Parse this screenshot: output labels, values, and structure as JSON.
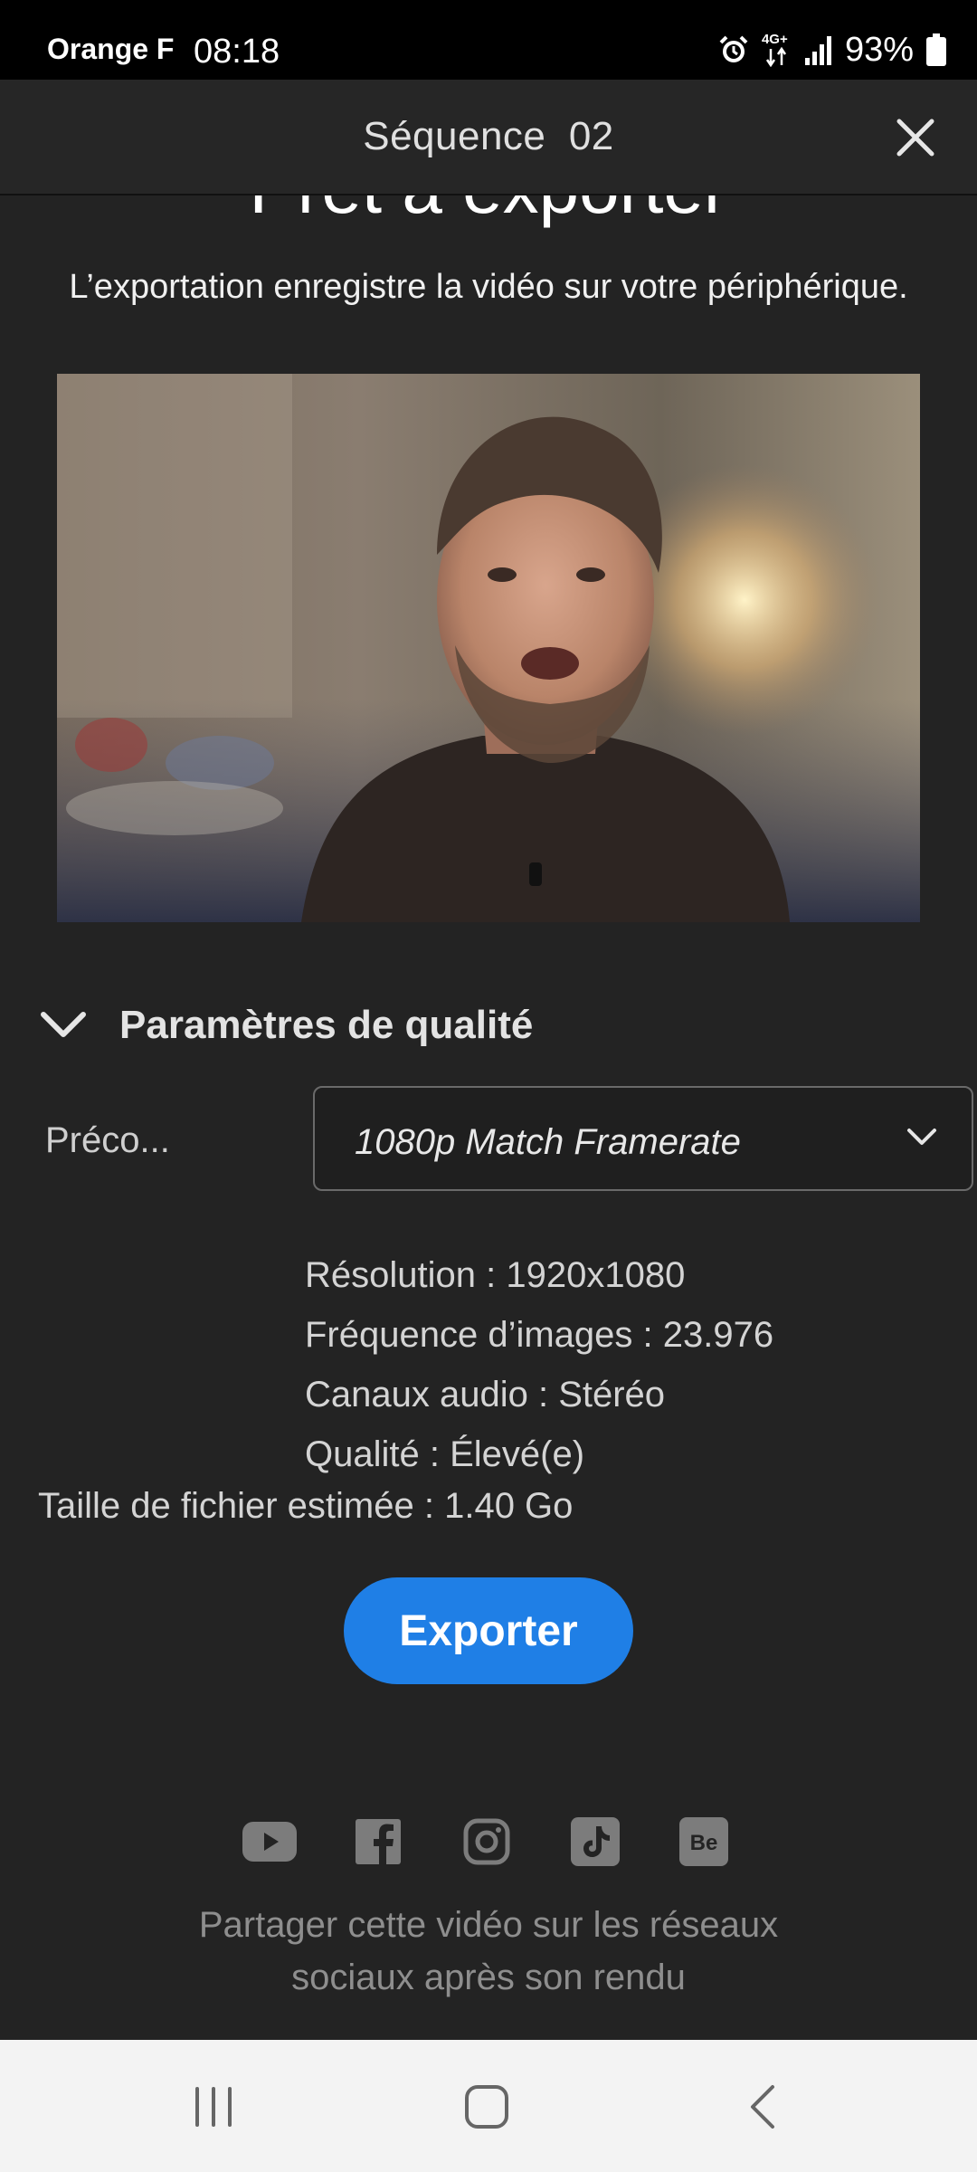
{
  "status_bar": {
    "carrier": "Orange F",
    "time": "08:18",
    "network": "4G+",
    "battery": "93%"
  },
  "header": {
    "title": "Séquence  02"
  },
  "main": {
    "title": "Prêt à exporter",
    "subtitle": "L’exportation enregistre la vidéo sur votre périphérique.",
    "quality_section_label": "Paramètres de qualité",
    "preset_label": "Préco...",
    "preset_value": "1080p Match Framerate",
    "specs": {
      "resolution": "Résolution : 1920x1080",
      "framerate": "Fréquence d’images : 23.976",
      "audio": "Canaux audio : Stéréo",
      "quality": "Qualité : Élevé(e)"
    },
    "file_size": "Taille de fichier estimée : 1.40 Go",
    "export_button": "Exporter"
  },
  "share": {
    "icons": [
      "youtube-icon",
      "facebook-icon",
      "instagram-icon",
      "tiktok-icon",
      "behance-icon"
    ],
    "text_line1": "Partager cette vidéo sur les réseaux",
    "text_line2": "sociaux après son rendu"
  },
  "colors": {
    "accent": "#1f7fe6",
    "background": "#232323",
    "status_bar": "#000000",
    "nav_bar": "#f3f3f3"
  }
}
